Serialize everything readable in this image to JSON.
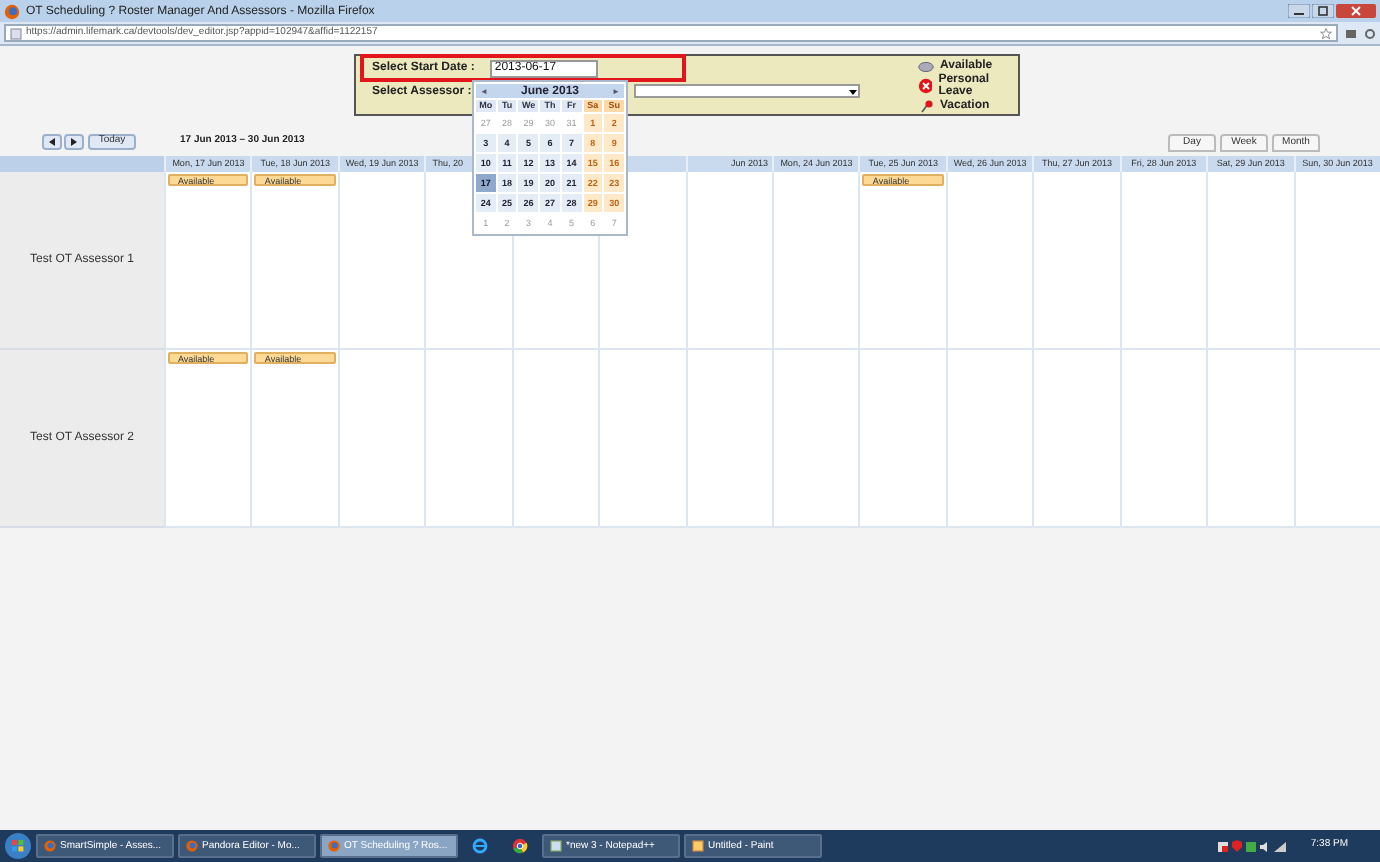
{
  "window": {
    "title": "OT Scheduling ? Roster Manager And Assessors - Mozilla Firefox"
  },
  "url": "https://admin.lifemark.ca/devtools/dev_editor.jsp?appid=102947&affid=1122157",
  "filter": {
    "start_label": "Select Start Date :",
    "start_value": "2013-06-17",
    "assessor_label": "Select Assessor :"
  },
  "legend": [
    {
      "kind": "available",
      "label": "Available"
    },
    {
      "kind": "leave",
      "label": "Personal Leave"
    },
    {
      "kind": "vacation",
      "label": "Vacation"
    }
  ],
  "toolbar": {
    "today": "Today",
    "range": "17 Jun 2013 – 30 Jun 2013",
    "views": [
      {
        "label": "Day",
        "selected": false
      },
      {
        "label": "Week",
        "selected": false
      },
      {
        "label": "Month",
        "selected": false
      }
    ]
  },
  "columns": [
    {
      "label": "Mon, 17 Jun 2013"
    },
    {
      "label": "Tue, 18 Jun 2013"
    },
    {
      "label": "Wed, 19 Jun 2013"
    },
    {
      "label": "Thu, 20"
    },
    {},
    {},
    {
      "label": "Jun 2013"
    },
    {
      "label": "Mon, 24 Jun 2013"
    },
    {
      "label": "Tue, 25 Jun 2013"
    },
    {
      "label": "Wed, 26 Jun 2013"
    },
    {
      "label": "Thu, 27 Jun 2013"
    },
    {
      "label": "Fri, 28 Jun 2013"
    },
    {
      "label": "Sat, 29 Jun 2013"
    },
    {
      "label": "Sun, 30 Jun 2013"
    }
  ],
  "rows": [
    {
      "name": "Test OT Assessor 1",
      "cells": [
        {
          "event": "Available"
        },
        {
          "event": "Available"
        },
        {},
        {},
        {},
        {},
        {},
        {},
        {
          "event": "Available"
        },
        {},
        {},
        {},
        {},
        {}
      ]
    },
    {
      "name": "Test OT Assessor 2",
      "cells": [
        {
          "event": "Available"
        },
        {
          "event": "Available"
        },
        {},
        {},
        {},
        {},
        {},
        {},
        {},
        {},
        {},
        {},
        {},
        {}
      ]
    }
  ],
  "datepicker": {
    "prev": "◄",
    "month": "June 2013",
    "next": "►",
    "weekdays": [
      "Mo",
      "Tu",
      "We",
      "Th",
      "Fr",
      "Sa",
      "Su"
    ],
    "days": [
      {
        "label": "27",
        "other": true,
        "selected": false
      },
      {
        "label": "28",
        "other": true,
        "selected": false
      },
      {
        "label": "29",
        "other": true,
        "selected": false
      },
      {
        "label": "30",
        "other": true,
        "selected": false
      },
      {
        "label": "31",
        "other": true,
        "selected": false
      },
      {
        "label": "1",
        "other": false,
        "selected": false
      },
      {
        "label": "2",
        "other": false,
        "selected": false
      },
      {
        "label": "3",
        "other": false,
        "selected": false
      },
      {
        "label": "4",
        "other": false,
        "selected": false
      },
      {
        "label": "5",
        "other": false,
        "selected": false
      },
      {
        "label": "6",
        "other": false,
        "selected": false
      },
      {
        "label": "7",
        "other": false,
        "selected": false
      },
      {
        "label": "8",
        "other": false,
        "selected": false
      },
      {
        "label": "9",
        "other": false,
        "selected": false
      },
      {
        "label": "10",
        "other": false,
        "selected": false
      },
      {
        "label": "11",
        "other": false,
        "selected": false
      },
      {
        "label": "12",
        "other": false,
        "selected": false
      },
      {
        "label": "13",
        "other": false,
        "selected": false
      },
      {
        "label": "14",
        "other": false,
        "selected": false
      },
      {
        "label": "15",
        "other": false,
        "selected": false
      },
      {
        "label": "16",
        "other": false,
        "selected": false
      },
      {
        "label": "17",
        "other": false,
        "selected": true
      },
      {
        "label": "18",
        "other": false,
        "selected": false
      },
      {
        "label": "19",
        "other": false,
        "selected": false
      },
      {
        "label": "20",
        "other": false,
        "selected": false
      },
      {
        "label": "21",
        "other": false,
        "selected": false
      },
      {
        "label": "22",
        "other": false,
        "selected": false
      },
      {
        "label": "23",
        "other": false,
        "selected": false
      },
      {
        "label": "24",
        "other": false,
        "selected": false
      },
      {
        "label": "25",
        "other": false,
        "selected": false
      },
      {
        "label": "26",
        "other": false,
        "selected": false
      },
      {
        "label": "27",
        "other": false,
        "selected": false
      },
      {
        "label": "28",
        "other": false,
        "selected": false
      },
      {
        "label": "29",
        "other": false,
        "selected": false
      },
      {
        "label": "30",
        "other": false,
        "selected": false
      },
      {
        "label": "1",
        "other": true,
        "selected": false
      },
      {
        "label": "2",
        "other": true,
        "selected": false
      },
      {
        "label": "3",
        "other": true,
        "selected": false
      },
      {
        "label": "4",
        "other": true,
        "selected": false
      },
      {
        "label": "5",
        "other": true,
        "selected": false
      },
      {
        "label": "6",
        "other": true,
        "selected": false
      },
      {
        "label": "7",
        "other": true,
        "selected": false
      }
    ]
  },
  "taskbar": {
    "items": [
      {
        "label": "SmartSimple - Asses...",
        "kind": "firefox",
        "selected": false
      },
      {
        "label": "Pandora Editor - Mo...",
        "kind": "firefox",
        "selected": false
      },
      {
        "label": "OT Scheduling ? Ros...",
        "kind": "firefox",
        "selected": true
      },
      {
        "kind": "ie",
        "selected": false
      },
      {
        "kind": "chrome",
        "selected": false
      },
      {
        "label": "*new 3 - Notepad++",
        "kind": "notepad",
        "selected": false
      },
      {
        "label": "Untitled - Paint",
        "kind": "paint",
        "selected": false
      }
    ],
    "clock": "7:38 PM"
  }
}
